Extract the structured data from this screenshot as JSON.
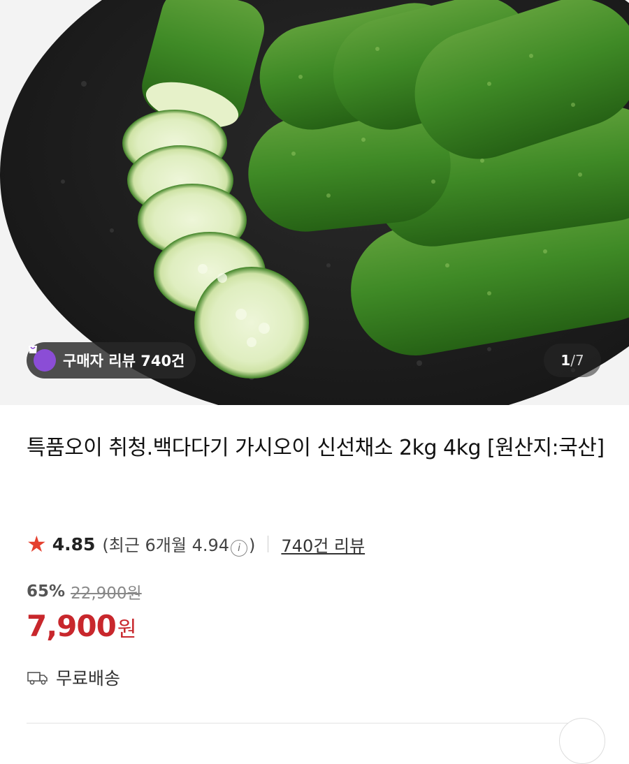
{
  "hero": {
    "review_badge": "구매자 리뷰 740건",
    "page_current": "1",
    "page_total": "/7"
  },
  "product": {
    "title": "특품오이 취청.백다다기 가시오이 신선채소 2kg 4kg [원산지:국산]",
    "rating": "4.85",
    "recent_prefix": "(최근 6개월 4.94",
    "recent_suffix": ")",
    "review_count": "740건 리뷰",
    "discount": "65%",
    "original_price": "22,900원",
    "price": "7,900",
    "price_unit": "원",
    "delivery": "무료배송"
  },
  "colors": {
    "price": "#c8272c",
    "star": "#e5402f",
    "badge_icon": "#8b4dd6"
  },
  "icons": [
    "shopping-bag-icon",
    "star-icon",
    "info-icon",
    "truck-icon"
  ]
}
